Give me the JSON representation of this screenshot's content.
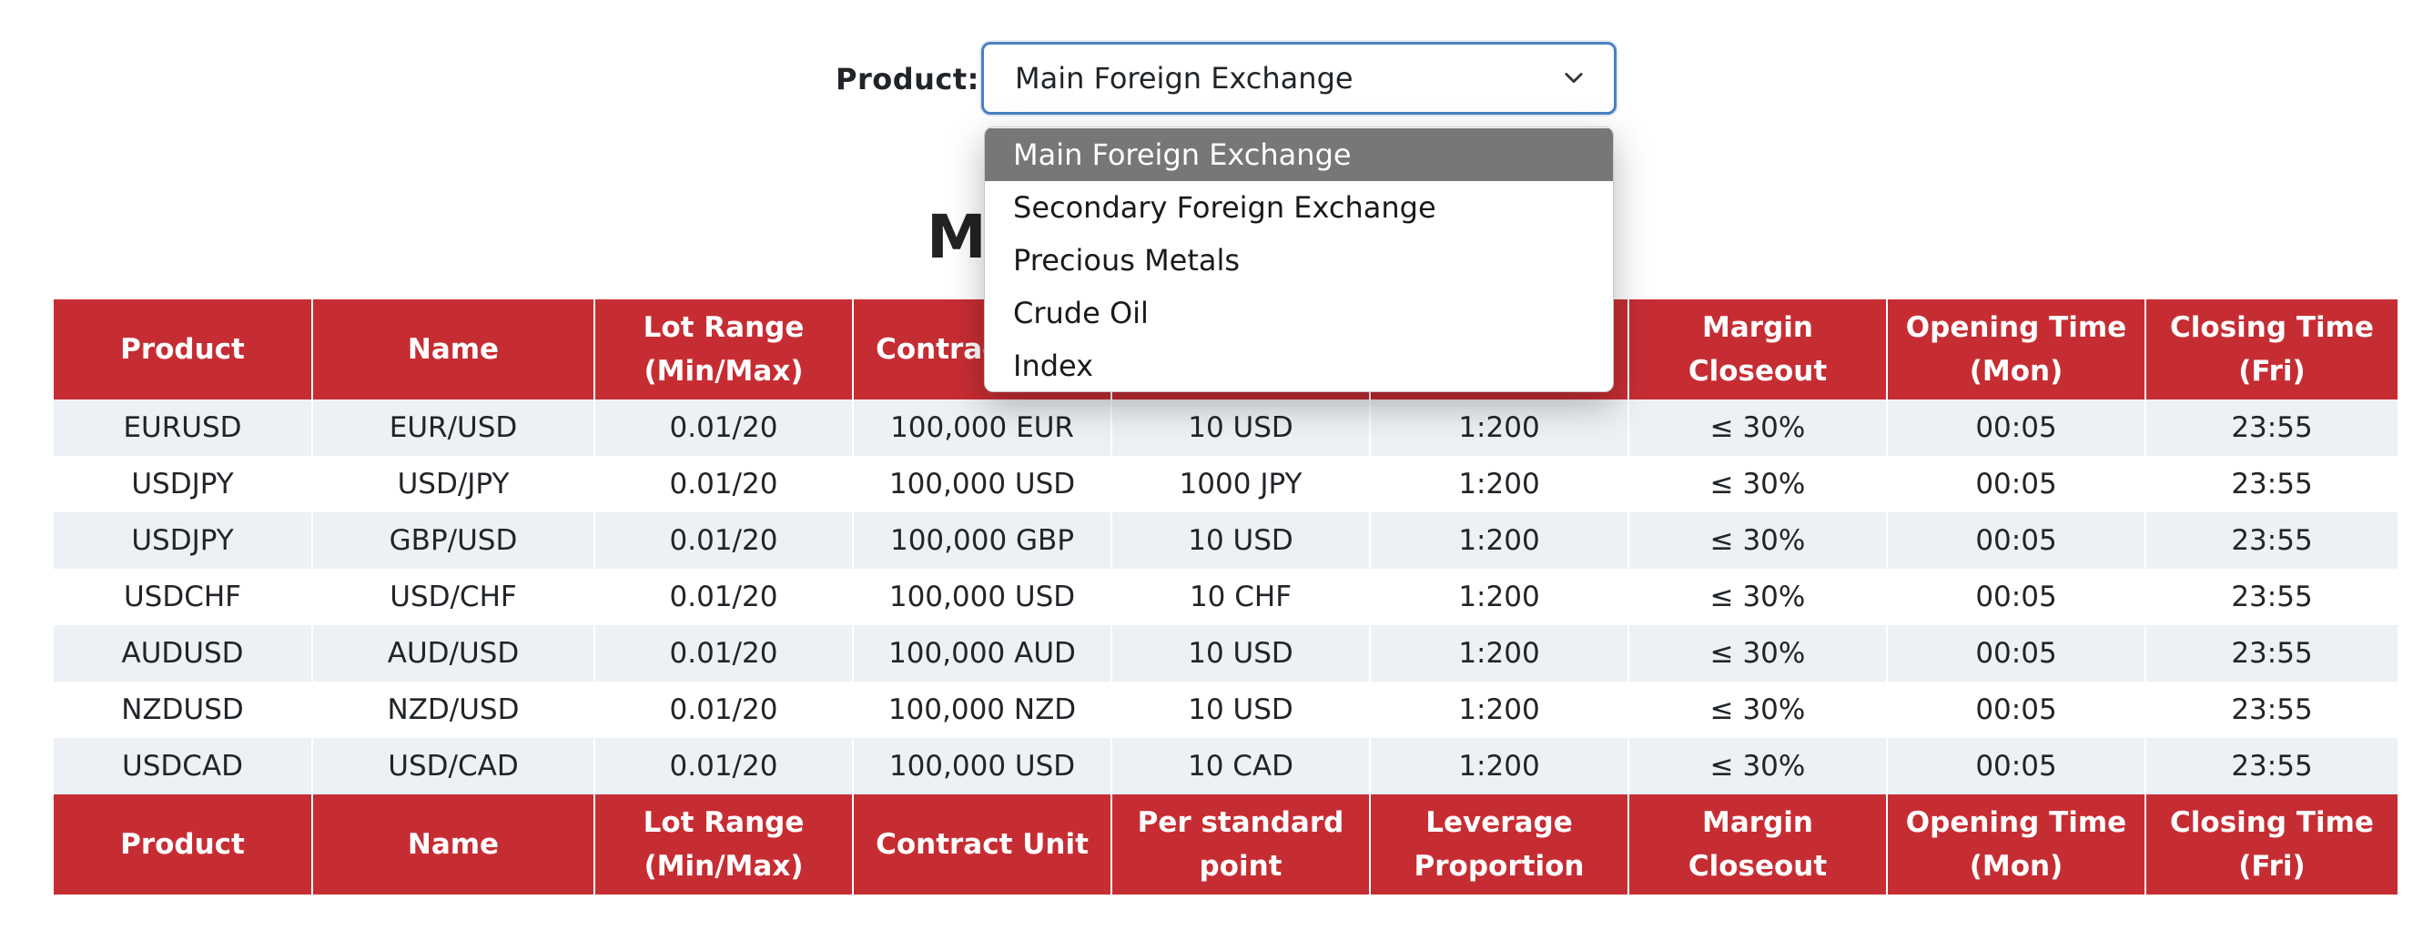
{
  "filter": {
    "label": "Product:",
    "selected": "Main Foreign Exchange",
    "options": [
      "Main Foreign Exchange",
      "Secondary Foreign Exchange",
      "Precious Metals",
      "Crude Oil",
      "Index"
    ]
  },
  "title": {
    "visible_text": "Ma"
  },
  "table": {
    "header": [
      {
        "line1": "Product",
        "line2": ""
      },
      {
        "line1": "Name",
        "line2": ""
      },
      {
        "line1": "Lot Range",
        "line2": "(Min/Max)"
      },
      {
        "line1": "Contract Unit",
        "line2": ""
      },
      {
        "line1": "Per standard",
        "line2": "point"
      },
      {
        "line1": "Leverage",
        "line2": "Proportion"
      },
      {
        "line1": "Margin Closeout",
        "line2": ""
      },
      {
        "line1": "Opening Time",
        "line2": "(Mon)"
      },
      {
        "line1": "Closing Time (Fri)",
        "line2": ""
      }
    ],
    "rows": [
      [
        "EURUSD",
        "EUR/USD",
        "0.01/20",
        "100,000 EUR",
        "10 USD",
        "1:200",
        "≤ 30%",
        "00:05",
        "23:55"
      ],
      [
        "USDJPY",
        "USD/JPY",
        "0.01/20",
        "100,000 USD",
        "1000 JPY",
        "1:200",
        "≤ 30%",
        "00:05",
        "23:55"
      ],
      [
        "USDJPY",
        "GBP/USD",
        "0.01/20",
        "100,000 GBP",
        "10 USD",
        "1:200",
        "≤ 30%",
        "00:05",
        "23:55"
      ],
      [
        "USDCHF",
        "USD/CHF",
        "0.01/20",
        "100,000 USD",
        "10 CHF",
        "1:200",
        "≤ 30%",
        "00:05",
        "23:55"
      ],
      [
        "AUDUSD",
        "AUD/USD",
        "0.01/20",
        "100,000 AUD",
        "10 USD",
        "1:200",
        "≤ 30%",
        "00:05",
        "23:55"
      ],
      [
        "NZDUSD",
        "NZD/USD",
        "0.01/20",
        "100,000 NZD",
        "10 USD",
        "1:200",
        "≤ 30%",
        "00:05",
        "23:55"
      ],
      [
        "USDCAD",
        "USD/CAD",
        "0.01/20",
        "100,000 USD",
        "10 CAD",
        "1:200",
        "≤ 30%",
        "00:05",
        "23:55"
      ]
    ]
  },
  "colors": {
    "header_bg": "#c62d33",
    "row_alt_bg": "#edf1f5",
    "select_border": "#4a80c0",
    "option_highlight": "#777777"
  },
  "icons": {
    "select_caret": "chevron-down-icon"
  }
}
